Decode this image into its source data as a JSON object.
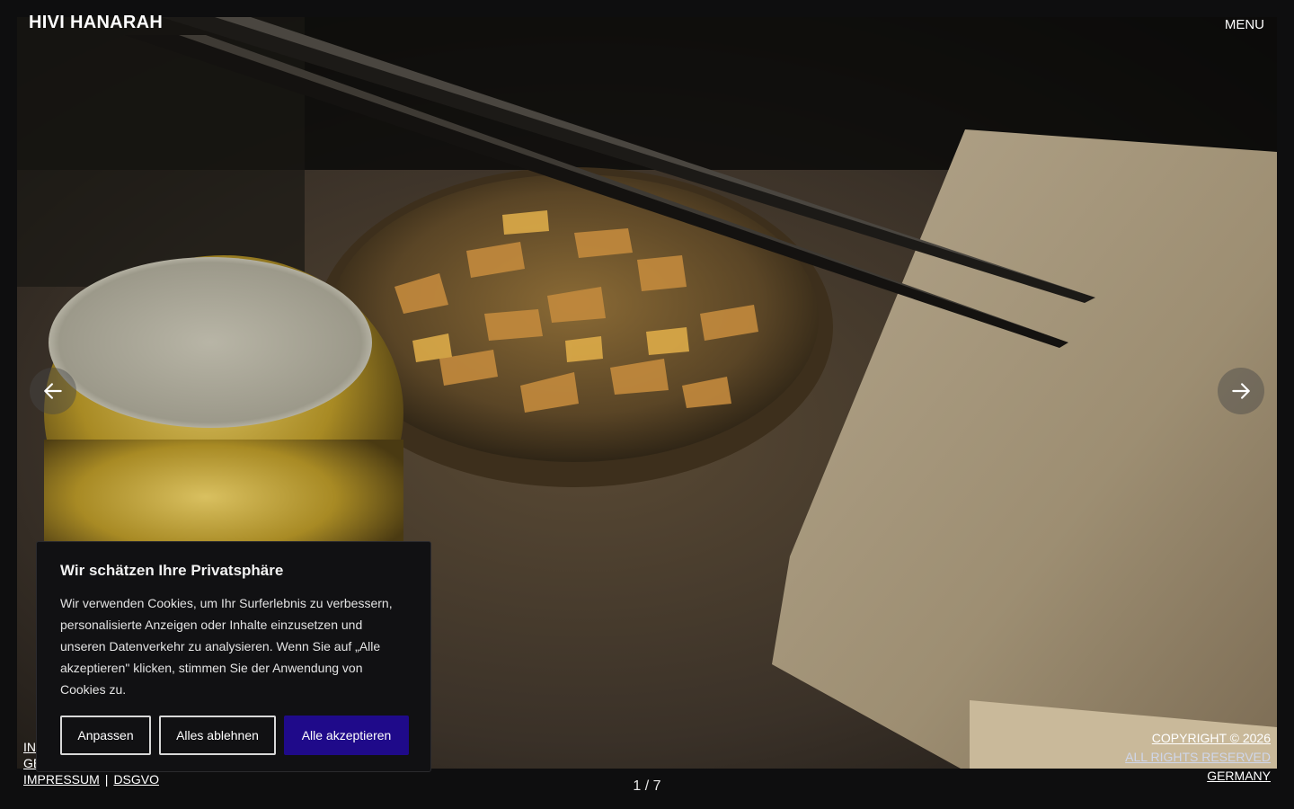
{
  "header": {
    "brand": "HIVI HANARAH",
    "menu_label": "MENU"
  },
  "slider": {
    "counter": "1 / 7",
    "prev_icon": "arrow-left-icon",
    "next_icon": "arrow-right-icon"
  },
  "footer": {
    "left_links": [
      "IN",
      "GE"
    ],
    "legal": [
      "IMPRESSUM",
      "DSGVO"
    ],
    "legal_separator": "|",
    "right_lines": [
      "COPYRIGHT © 2026",
      "ALL RIGHTS RESERVED",
      "GERMANY"
    ]
  },
  "cookie_banner": {
    "title": "Wir schätzen Ihre Privatsphäre",
    "text": "Wir verwenden Cookies, um Ihr Surferlebnis zu verbessern, personalisierte Anzeigen oder Inhalte einzusetzen und unseren Datenverkehr zu analysieren. Wenn Sie auf „Alle akzeptieren\" klicken, stimmen Sie der Anwendung von Cookies zu.",
    "buttons": {
      "customize": "Anpassen",
      "reject": "Alles ablehnen",
      "accept": "Alle akzeptieren"
    },
    "accent_color": "#1f0a8a"
  }
}
